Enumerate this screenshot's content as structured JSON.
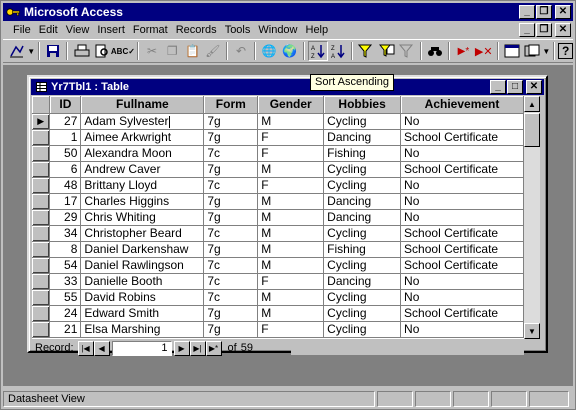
{
  "app": {
    "title": "Microsoft Access"
  },
  "menu": [
    "File",
    "Edit",
    "View",
    "Insert",
    "Format",
    "Records",
    "Tools",
    "Window",
    "Help"
  ],
  "tooltip": "Sort Ascending",
  "table_window": {
    "title": "Yr7Tbl1 : Table"
  },
  "columns": [
    "ID",
    "Fullname",
    "Form",
    "Gender",
    "Hobbies",
    "Achievement"
  ],
  "rows": [
    {
      "id": "27",
      "name": "Adam Sylvester",
      "form": "7g",
      "gender": "M",
      "hobby": "Cycling",
      "ach": "No"
    },
    {
      "id": "1",
      "name": "Aimee Arkwright",
      "form": "7g",
      "gender": "F",
      "hobby": "Dancing",
      "ach": "School Certificate"
    },
    {
      "id": "50",
      "name": "Alexandra Moon",
      "form": "7c",
      "gender": "F",
      "hobby": "Fishing",
      "ach": "No"
    },
    {
      "id": "6",
      "name": "Andrew Caver",
      "form": "7g",
      "gender": "M",
      "hobby": "Cycling",
      "ach": "School Certificate"
    },
    {
      "id": "48",
      "name": "Brittany Lloyd",
      "form": "7c",
      "gender": "F",
      "hobby": "Cycling",
      "ach": "No"
    },
    {
      "id": "17",
      "name": "Charles Higgins",
      "form": "7g",
      "gender": "M",
      "hobby": "Dancing",
      "ach": "No"
    },
    {
      "id": "29",
      "name": "Chris Whiting",
      "form": "7g",
      "gender": "M",
      "hobby": "Dancing",
      "ach": "No"
    },
    {
      "id": "34",
      "name": "Christopher Beard",
      "form": "7c",
      "gender": "M",
      "hobby": "Cycling",
      "ach": "School Certificate"
    },
    {
      "id": "8",
      "name": "Daniel Darkenshaw",
      "form": "7g",
      "gender": "M",
      "hobby": "Fishing",
      "ach": "School Certificate"
    },
    {
      "id": "54",
      "name": "Daniel Rawlingson",
      "form": "7c",
      "gender": "M",
      "hobby": "Cycling",
      "ach": "School Certificate"
    },
    {
      "id": "33",
      "name": "Danielle Booth",
      "form": "7c",
      "gender": "F",
      "hobby": "Dancing",
      "ach": "No"
    },
    {
      "id": "55",
      "name": "David Robins",
      "form": "7c",
      "gender": "M",
      "hobby": "Cycling",
      "ach": "No"
    },
    {
      "id": "24",
      "name": "Edward Smith",
      "form": "7g",
      "gender": "M",
      "hobby": "Cycling",
      "ach": "School Certificate"
    },
    {
      "id": "21",
      "name": "Elsa Marshing",
      "form": "7g",
      "gender": "F",
      "hobby": "Cycling",
      "ach": "No"
    }
  ],
  "nav": {
    "label": "Record:",
    "current": "1",
    "of_label": "of",
    "total": "59"
  },
  "status": {
    "text": "Datasheet View"
  }
}
